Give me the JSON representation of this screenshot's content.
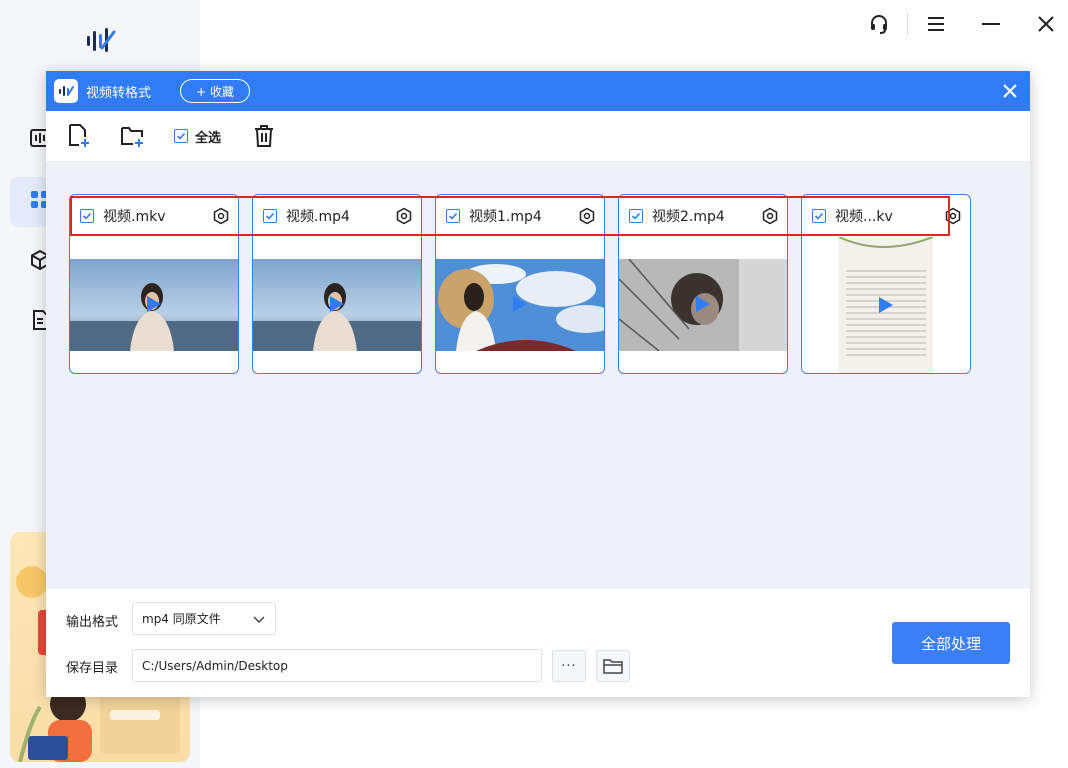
{
  "dialog": {
    "title": "视频转格式",
    "favorite_label": "+ 收藏"
  },
  "toolbar": {
    "select_all_label": "全选"
  },
  "files": [
    {
      "name": "视频.mkv",
      "checked": true
    },
    {
      "name": "视频.mp4",
      "checked": true
    },
    {
      "name": "视频1.mp4",
      "checked": true
    },
    {
      "name": "视频2.mp4",
      "checked": true
    },
    {
      "name": "视频...kv",
      "checked": true
    }
  ],
  "output": {
    "format_label": "输出格式",
    "format_value": "mp4 同原文件",
    "save_label": "保存目录",
    "save_path": "C:/Users/Admin/Desktop",
    "more_label": "···"
  },
  "actions": {
    "process_all_label": "全部处理"
  },
  "colors": {
    "accent": "#2f7cf6",
    "highlight": "#e0281f"
  }
}
